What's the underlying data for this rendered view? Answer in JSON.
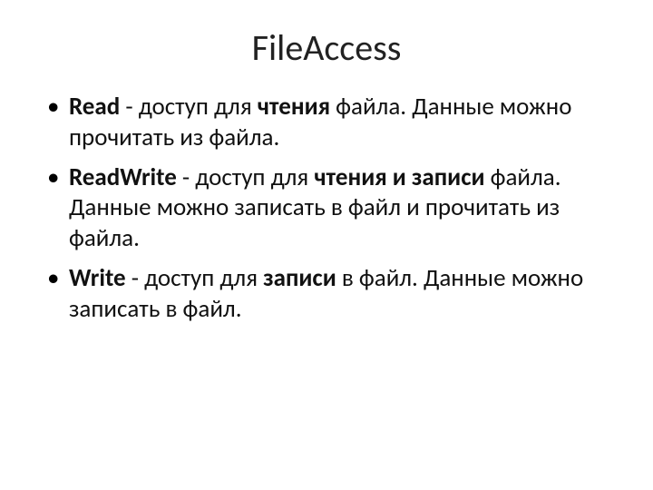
{
  "title": "FileAccess",
  "items": [
    {
      "term": "Read",
      "pre": " - доступ для ",
      "emph": "чтения",
      "post": " файла. Данные можно прочитать из файла."
    },
    {
      "term": "ReadWrite",
      "pre": " - доступ для ",
      "emph": "чтения и записи",
      "post": " файла. Данные можно записать в файл и прочитать из файла."
    },
    {
      "term": "Write",
      "pre": " - доступ для ",
      "emph": "записи",
      "post": " в файл. Данные можно записать в файл."
    }
  ]
}
